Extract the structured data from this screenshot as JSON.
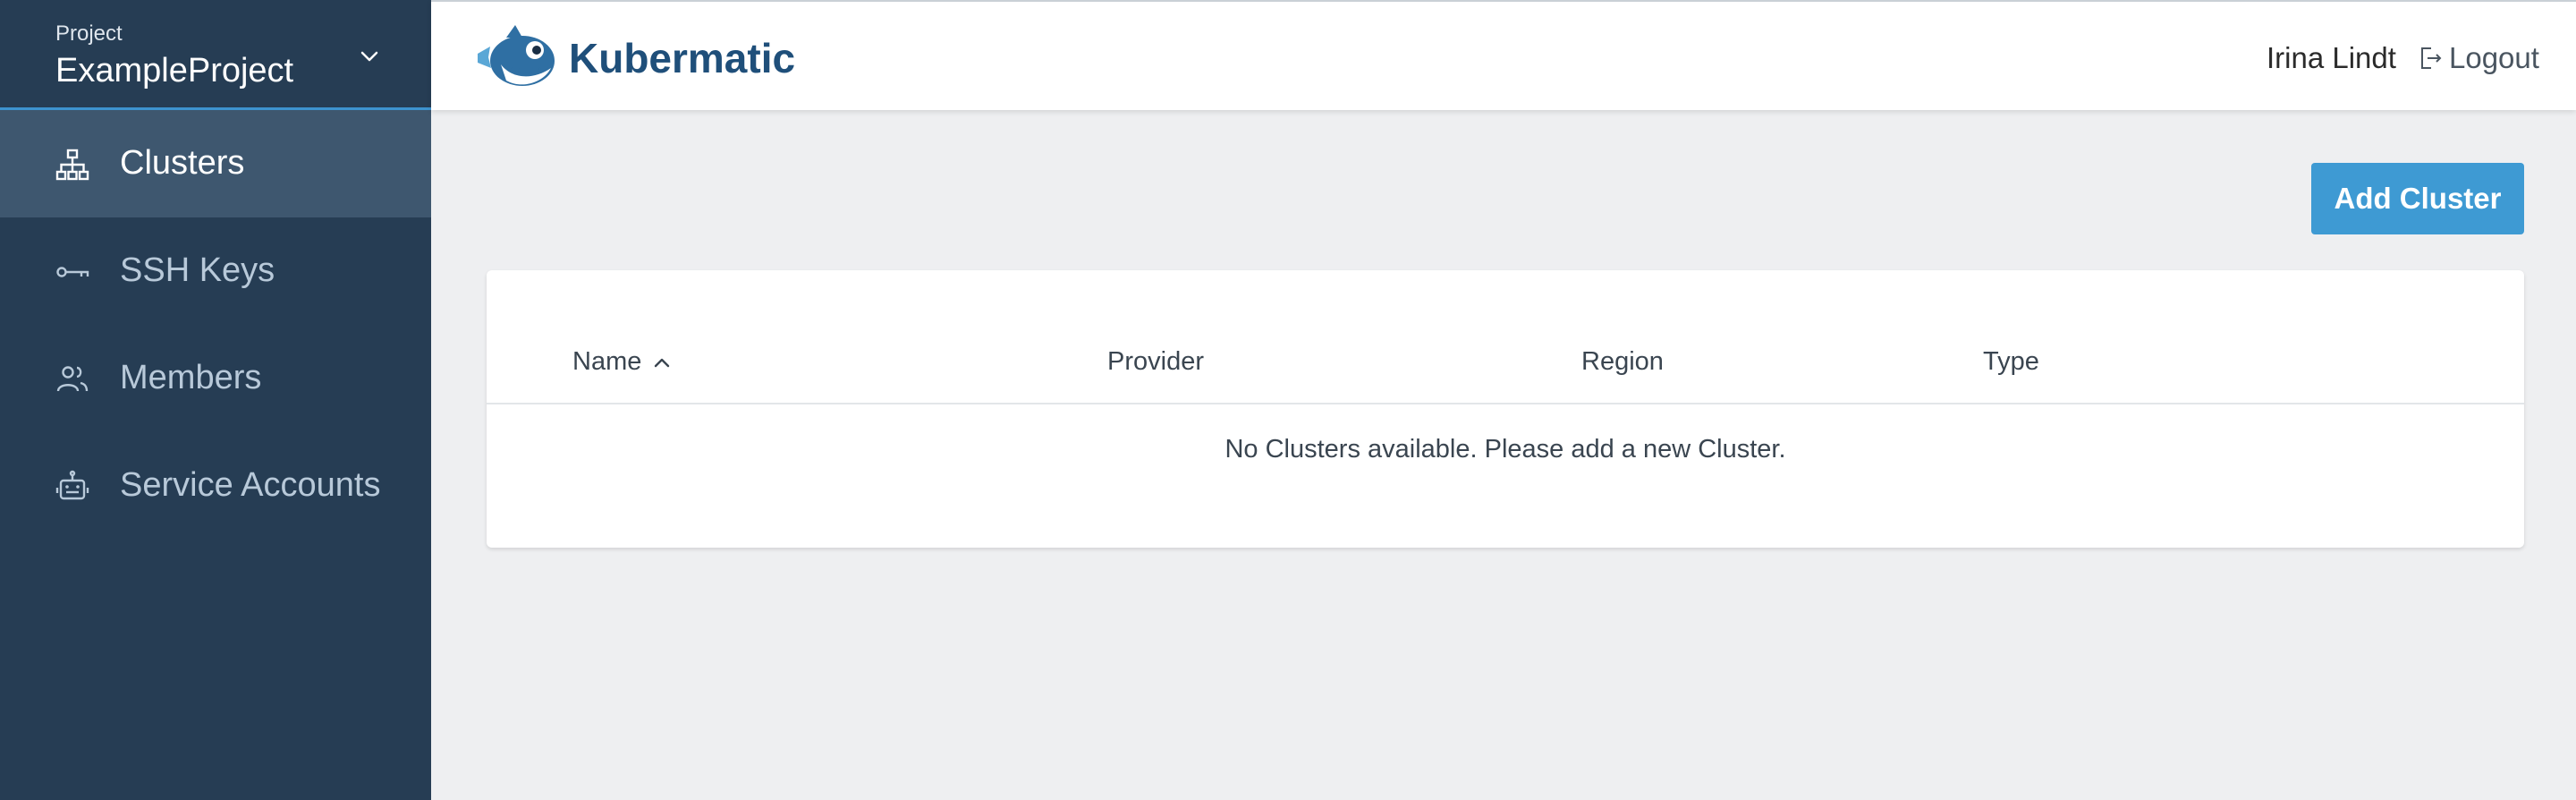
{
  "sidebar": {
    "project_label": "Project",
    "project_name": "ExampleProject",
    "items": [
      {
        "label": "Clusters",
        "icon": "sitemap-icon",
        "active": true
      },
      {
        "label": "SSH Keys",
        "icon": "key-icon",
        "active": false
      },
      {
        "label": "Members",
        "icon": "users-icon",
        "active": false
      },
      {
        "label": "Service Accounts",
        "icon": "robot-icon",
        "active": false
      }
    ]
  },
  "header": {
    "logo_text": "Kubermatic",
    "user_name": "Irina Lindt",
    "logout_label": "Logout"
  },
  "main": {
    "add_cluster_label": "Add Cluster",
    "table": {
      "columns": [
        "Name",
        "Provider",
        "Region",
        "Type"
      ],
      "sort_column": "Name",
      "sort_direction": "ascending",
      "empty_message": "No Clusters available. Please add a new Cluster."
    }
  },
  "colors": {
    "sidebar_bg": "#263d54",
    "sidebar_active": "#3e576f",
    "accent": "#3e9ad3",
    "page_bg": "#eeeff1",
    "brand_text": "#1f4f7a"
  }
}
